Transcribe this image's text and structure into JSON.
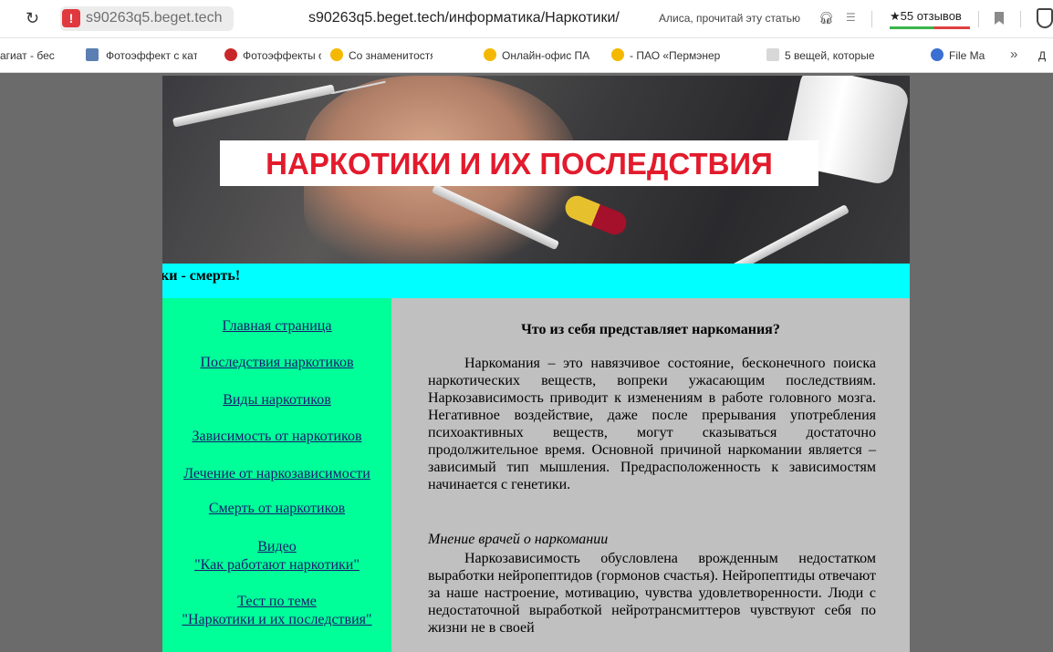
{
  "browser": {
    "domain": "s90263q5.beget.tech",
    "url_path": "s90263q5.beget.tech/информатика/Наркотики/",
    "alisa_prompt": "Алиса, прочитай эту статью",
    "reviews": "★55 отзывов"
  },
  "bookmarks": [
    "агиат - бес",
    "Фотоэффект с кате",
    "Фотоэффекты онл",
    "Со знаменитостям",
    "Онлайн-офис ПАС",
    "- ПАО «Пермэнерг",
    "5 вещей, которые",
    "File Ma",
    "»",
    "Д"
  ],
  "banner": {
    "title": "НАРКОТИКИ И ИХ ПОСЛЕДСТВИЯ"
  },
  "marquee": {
    "text": "ки - смерть!"
  },
  "nav": {
    "items": [
      "Главная страница",
      "Последствия наркотиков",
      "Виды наркотиков",
      "Зависимость от наркотиков",
      "Лечение от наркозависимости",
      "Смерть от наркотиков"
    ],
    "video_line1": "Видео",
    "video_line2": "\"Как работают наркотики\"",
    "test_line1": "Тест по теме",
    "test_line2": "\"Наркотики и их последствия\""
  },
  "content": {
    "heading": "Что из себя представляет наркомания?",
    "paragraph1": "Наркомания – это навязчивое состояние, бесконечного поиска наркотических веществ, вопреки ужасающим последствиям. Наркозависимость приводит к изменениям в работе головного мозга. Негативное воздействие, даже после прерывания употребления психоактивных веществ, могут сказываться достаточно продолжительное время. Основной причиной наркомании является – зависимый тип мышления. Предрасположенность к зависимостям начинается с генетики.",
    "subheading": "Мнение врачей о наркомании",
    "paragraph2": "Наркозависимость обусловлена врожденным недостатком выработки нейропептидов (гормонов счастья). Нейропептиды отвечают за наше настроение, мотивацию, чувства удовлетворенности. Люди с недостаточной выработкой нейротрансмиттеров чувствуют себя по жизни не в своей"
  },
  "colors": {
    "page_bg": "#6b6b6b",
    "banner_title": "#e21b2c",
    "marquee_bg": "#00ffff",
    "nav_bg": "#00ff99",
    "content_bg": "#c0c0c0",
    "link": "#1a1a6e"
  }
}
